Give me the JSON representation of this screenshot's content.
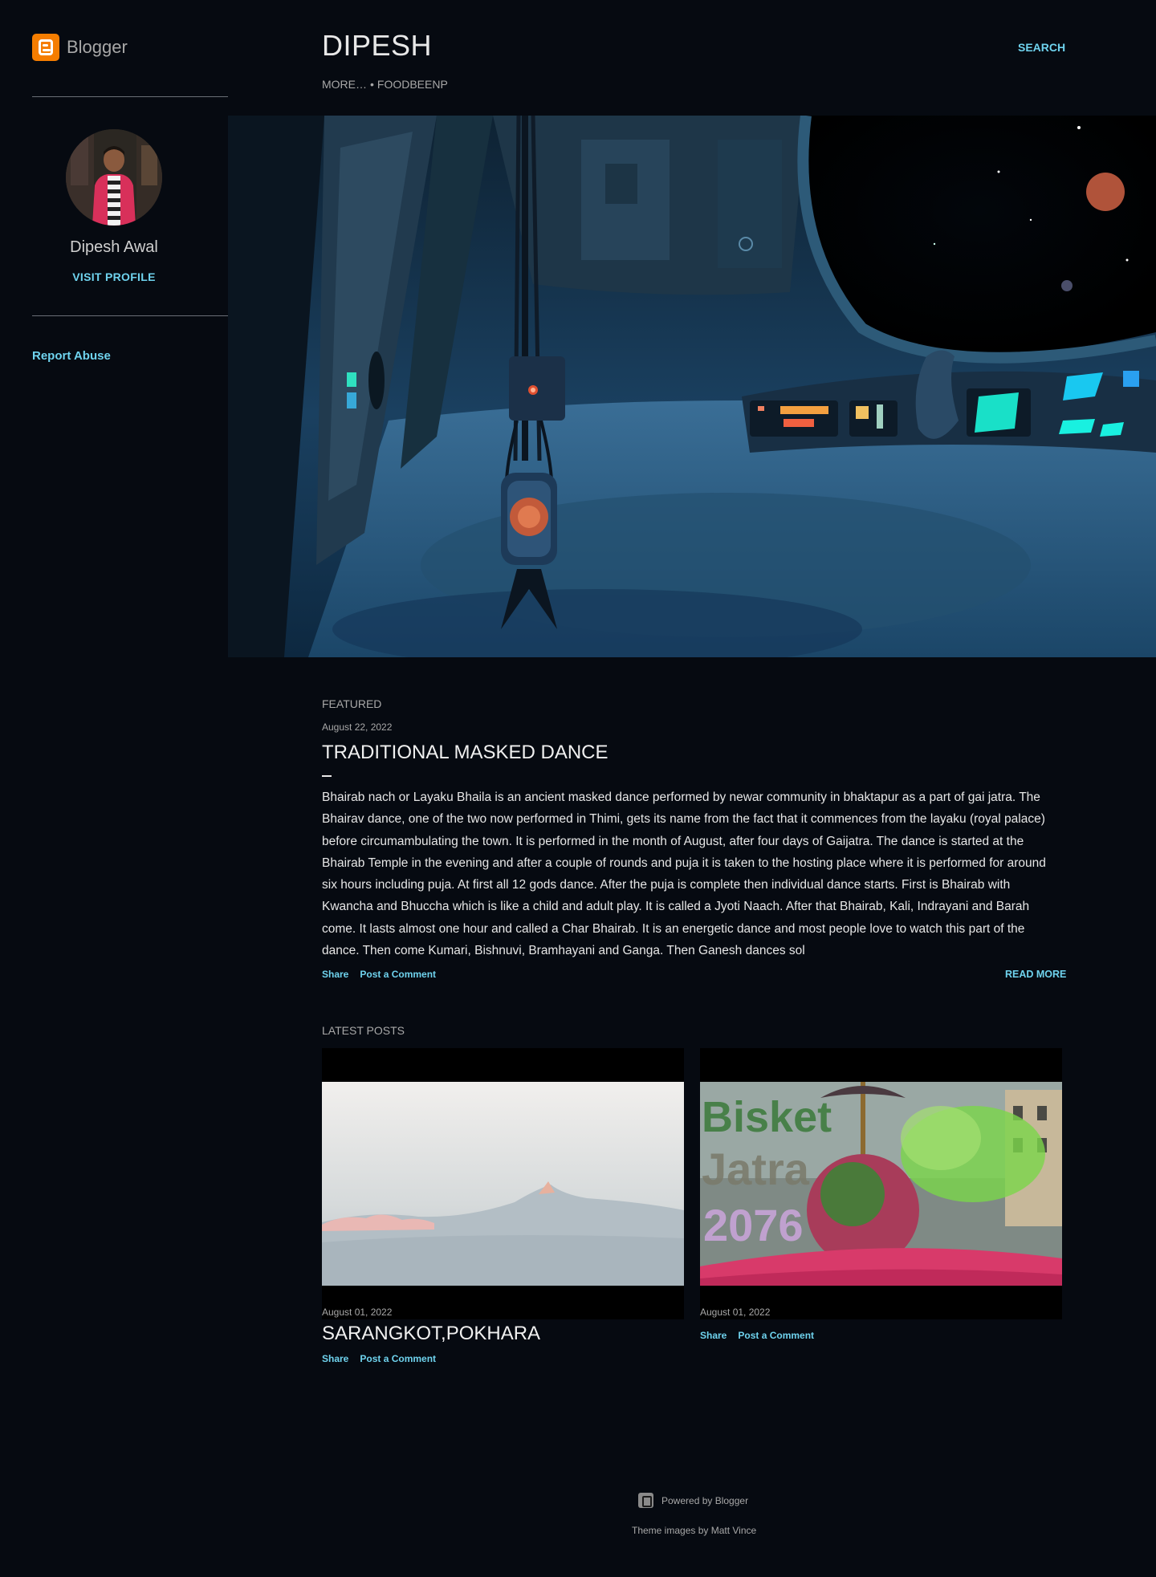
{
  "brand": {
    "name": "Blogger",
    "icon": "blogger-icon"
  },
  "profile": {
    "name": "Dipesh Awal",
    "visit_label": "VISIT PROFILE"
  },
  "sidebar": {
    "report_abuse": "Report Abuse"
  },
  "header": {
    "title": "DIPESH",
    "nav_more": "MORE…",
    "nav_separator": "•",
    "nav_item": "FOODBEENP",
    "search_label": "SEARCH"
  },
  "featured": {
    "section_label": "FEATURED",
    "date": "August 22, 2022",
    "title": "TRADITIONAL MASKED DANCE",
    "snippet": "  Bhairab nach or Layaku Bhaila is an ancient masked dance performed by newar community in bhaktapur as a part of gai jatra. The Bhairav dance, one of the two now performed in Thimi, gets its name from the fact that it commences from the layaku (royal palace) before circumambulating the town. It is performed in the month of August, after four days of Gaijatra. The dance is started at the Bhairab Temple in the evening and after a couple of rounds and puja it is taken to the hosting place where it is performed for around six hours including puja. At first all 12 gods dance. After the puja is complete then individual dance starts. First is Bhairab with Kwancha and Bhuccha which is like a child and adult play. It is called a Jyoti Naach. After that Bhairab, Kali, Indrayani and Barah come. It lasts almost one hour and called a Char Bhairab. It is an energetic dance and most people love to watch this part of the dance. Then come Kumari, Bishnuvi, Bramhayani and Ganga. Then Ganesh dances sol",
    "share": "Share",
    "comment": "Post a Comment",
    "read_more": "READ MORE"
  },
  "latest": {
    "section_label": "LATEST POSTS",
    "posts": [
      {
        "date": "August 01, 2022",
        "title": "SARANGKOT,POKHARA",
        "share": "Share",
        "comment": "Post a Comment"
      },
      {
        "date": "August 01, 2022",
        "image_text": [
          "Bisket",
          "Jatra",
          "2076"
        ],
        "share": "Share",
        "comment": "Post a Comment"
      }
    ]
  },
  "footer": {
    "powered": "Powered by Blogger",
    "theme": "Theme images by Matt Vince"
  },
  "colors": {
    "background": "#060a11",
    "link": "#6fd3ee",
    "muted": "#a8a8a8",
    "brand_orange": "#f57d00"
  }
}
